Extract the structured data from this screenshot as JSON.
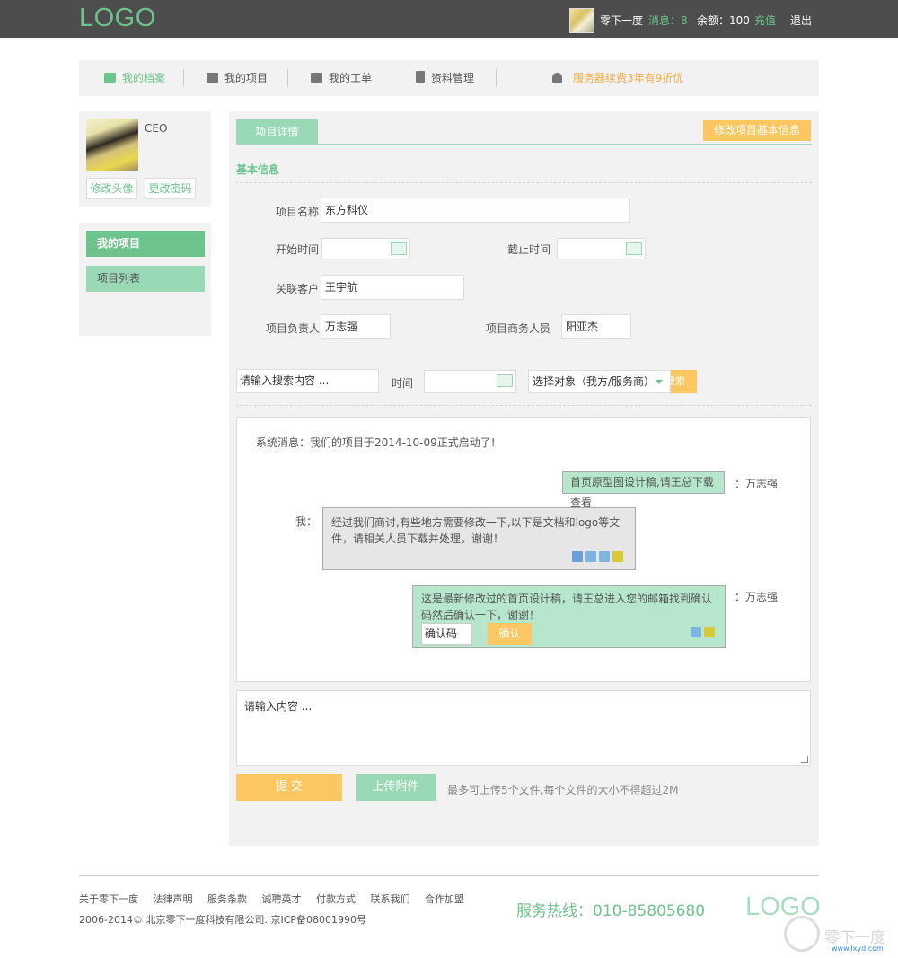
{
  "header": {
    "logo": "LOGO",
    "username": "零下一度",
    "messages": "消息：8",
    "balance": "余额：100",
    "recharge": "充值",
    "logout": "退出"
  },
  "nav": {
    "items": [
      {
        "label": "我的档案",
        "icon": "profile-icon"
      },
      {
        "label": "我的项目",
        "icon": "briefcase-icon"
      },
      {
        "label": "我的工单",
        "icon": "printer-icon"
      },
      {
        "label": "资料管理",
        "icon": "document-icon"
      }
    ],
    "promo": "服务器续费3年有9折优"
  },
  "profile": {
    "role": "CEO",
    "change_avatar": "修改头像",
    "change_password": "更改密码"
  },
  "sidebar": {
    "title": "我的项目",
    "items": [
      {
        "label": "项目列表"
      }
    ]
  },
  "main": {
    "tab": "项目详情",
    "edit_button": "修改项目基本信息",
    "section_title": "基本信息",
    "fields": {
      "name_label": "项目名称",
      "name_value": "东方科仪",
      "start_label": "开始时间",
      "start_value": "",
      "end_label": "截止时间",
      "end_value": "",
      "client_label": "关联客户",
      "client_value": "王宇航",
      "owner_label": "项目负责人",
      "owner_value": "万志强",
      "business_label": "项目商务人员",
      "business_value": "阳亚杰"
    },
    "filter": {
      "search_placeholder": "请输入搜索内容 ...",
      "time_label": "时间",
      "time_value": "",
      "select_value": "选择对象（我方/服务商）",
      "search_button": "搜索"
    }
  },
  "chat": {
    "system": "系统消息：我们的项目于2014-10-09正式启动了!",
    "messages": [
      {
        "text": "首页原型图设计稿,请王总下载查看",
        "speaker": "：万志强"
      },
      {
        "text": "经过我们商讨,有些地方需要修改一下,以下是文档和logo等文件，请相关人员下载并处理，谢谢！",
        "speaker": "我："
      },
      {
        "text": "这是最新修改过的首页设计稿，请王总进入您的邮箱找到确认码然后确认一下，谢谢！",
        "speaker": "：万志强",
        "code": "确认码",
        "confirm": "确认"
      }
    ]
  },
  "compose": {
    "placeholder": "请输入内容  ...",
    "submit": "提 交",
    "upload": "上传附件",
    "note": "最多可上传5个文件,每个文件的大小不得超过2M"
  },
  "footer": {
    "links": [
      "关于零下一度",
      "法律声明",
      "服务条款",
      "诚聘英才",
      "付款方式",
      "联系我们",
      "合作加盟"
    ],
    "copyright": "2006-2014© 北京零下一度科技有限公司.  京ICP备08001990号",
    "hotline": "服务热线：010-85805680",
    "logo": "LOGO",
    "watermark": "零下一度",
    "watermark_url": "www.lxyd.com"
  },
  "colors": {
    "accent": "#6cc48c",
    "accent_light": "#9ad9b5",
    "warning": "#fcc761",
    "header_bg": "#4d4d4d"
  }
}
